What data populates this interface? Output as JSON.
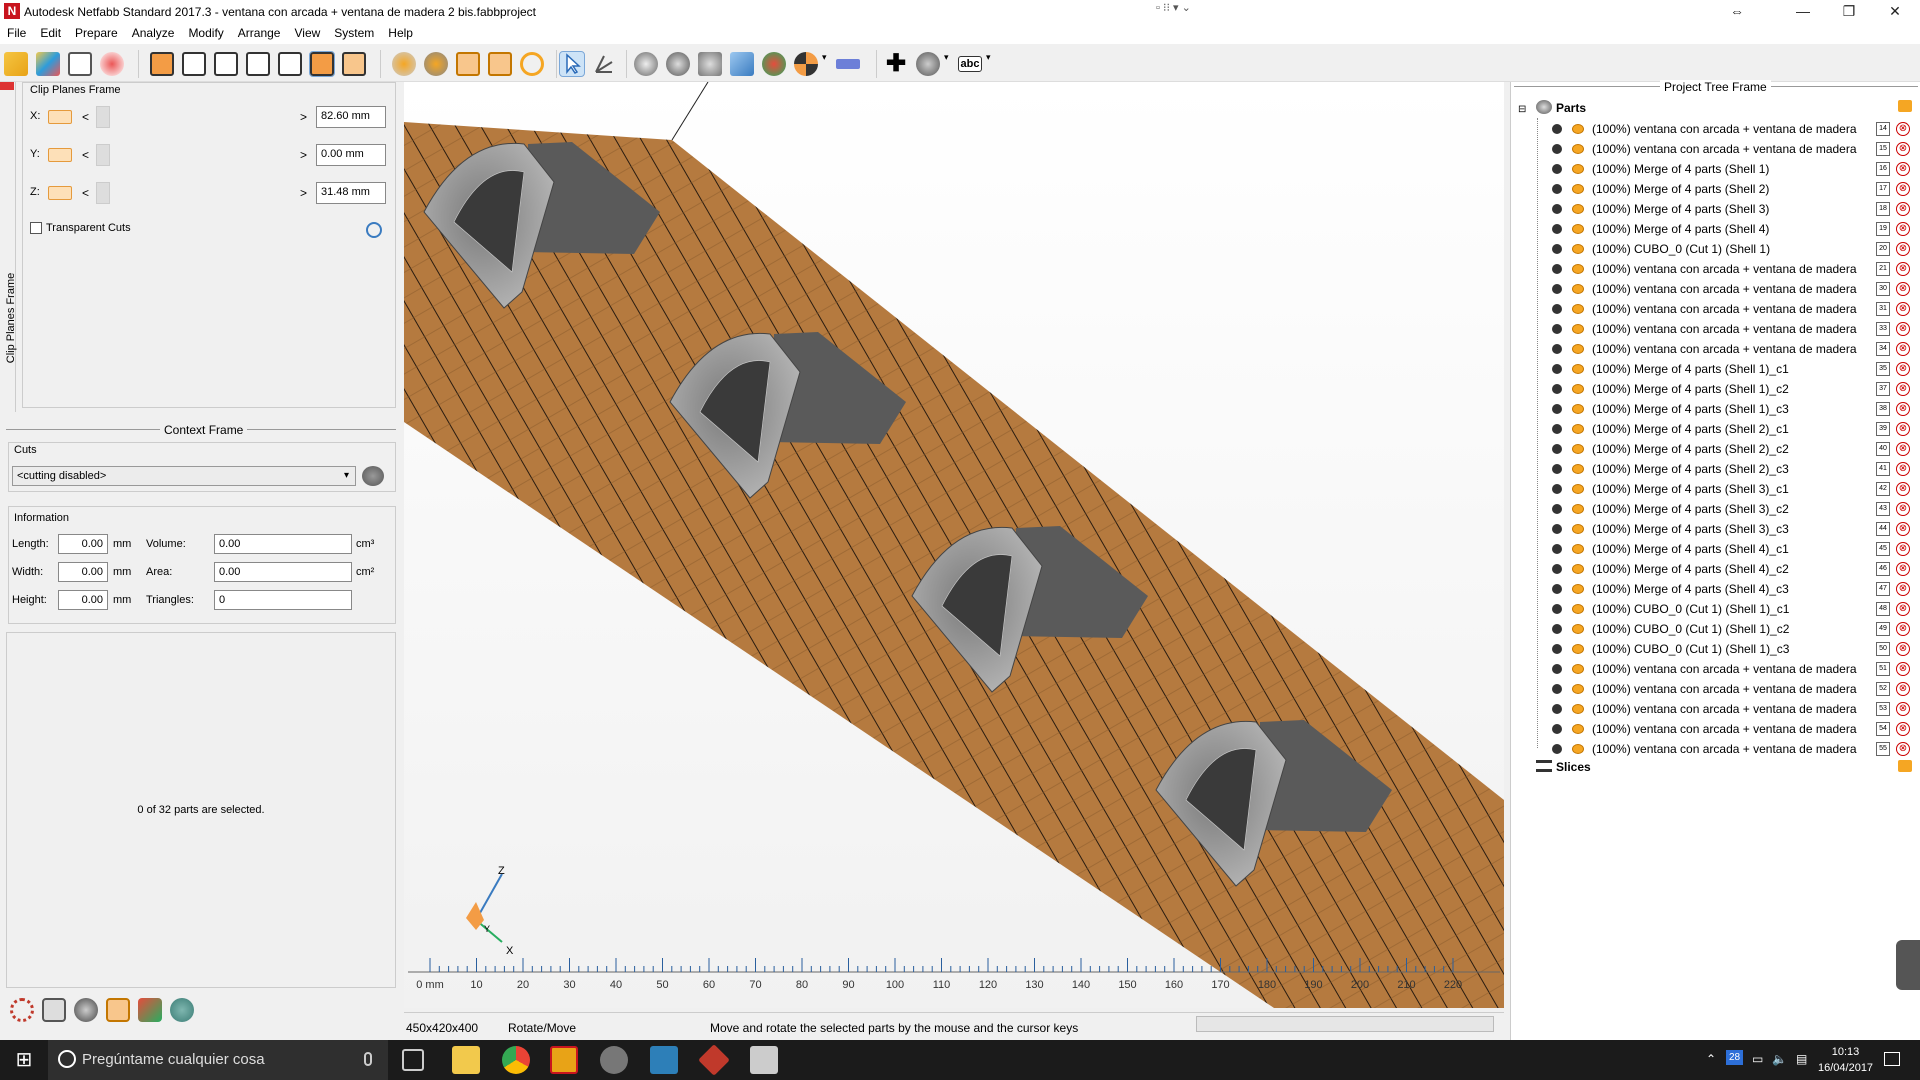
{
  "window": {
    "title": "Autodesk Netfabb Standard 2017.3 - ventana con arcada + ventana de madera 2 bis.fabbproject",
    "app_icon": "N",
    "controls": [
      "⇔",
      "—",
      "❐",
      "✕"
    ],
    "mini_controls": "▫ ⁝⁝ ▾ ⌄"
  },
  "menu": [
    "File",
    "Edit",
    "Prepare",
    "Analyze",
    "Modify",
    "Arrange",
    "View",
    "System",
    "Help"
  ],
  "clip_planes": {
    "tab_label": "Clip Planes Frame",
    "title": "Clip Planes Frame",
    "axes": [
      {
        "label": "X:",
        "value": "82.60 mm"
      },
      {
        "label": "Y:",
        "value": "0.00 mm"
      },
      {
        "label": "Z:",
        "value": "31.48 mm"
      }
    ],
    "arrow_left": "<",
    "arrow_right": ">",
    "transparent_cuts": "Transparent Cuts"
  },
  "context": {
    "title": "Context Frame",
    "cuts_label": "Cuts",
    "cuts_value": "<cutting disabled>",
    "info_label": "Information",
    "length_label": "Length:",
    "length_value": "0.00",
    "width_label": "Width:",
    "width_value": "0.00",
    "height_label": "Height:",
    "height_value": "0.00",
    "unit_mm": "mm",
    "volume_label": "Volume:",
    "volume_value": "0.00",
    "area_label": "Area:",
    "area_value": "0.00",
    "triangles_label": "Triangles:",
    "triangles_value": "0",
    "unit_cm3": "cm³",
    "unit_cm2": "cm²",
    "selection_text": "0 of 32 parts are selected."
  },
  "ruler": {
    "labels": [
      "0 mm",
      "10",
      "20",
      "30",
      "40",
      "50",
      "60",
      "70",
      "80",
      "90",
      "100",
      "110",
      "120",
      "130",
      "140",
      "150",
      "160",
      "170",
      "180",
      "190",
      "200",
      "210",
      "220"
    ]
  },
  "axes_gizmo": {
    "z": "Z",
    "x": "X",
    "y": "Y"
  },
  "status": {
    "dimensions": "450x420x400",
    "mode": "Rotate/Move",
    "hint": "Move and rotate the selected parts by the mouse and the cursor keys"
  },
  "tree": {
    "title": "Project Tree Frame",
    "root": "Parts",
    "slices": "Slices",
    "items": [
      {
        "text": "(100%) ventana con arcada + ventana de madera",
        "num": "14"
      },
      {
        "text": "(100%) ventana con arcada + ventana de madera",
        "num": "15"
      },
      {
        "text": "(100%) Merge of 4 parts (Shell 1)",
        "num": "16"
      },
      {
        "text": "(100%) Merge of 4 parts (Shell 2)",
        "num": "17"
      },
      {
        "text": "(100%) Merge of 4 parts (Shell 3)",
        "num": "18"
      },
      {
        "text": "(100%) Merge of 4 parts (Shell 4)",
        "num": "19"
      },
      {
        "text": "(100%) CUBO_0 (Cut 1) (Shell 1)",
        "num": "20"
      },
      {
        "text": "(100%) ventana con arcada + ventana de madera",
        "num": "21"
      },
      {
        "text": "(100%) ventana con arcada + ventana de madera",
        "num": "30"
      },
      {
        "text": "(100%) ventana con arcada + ventana de madera",
        "num": "31"
      },
      {
        "text": "(100%) ventana con arcada + ventana de madera",
        "num": "33"
      },
      {
        "text": "(100%) ventana con arcada + ventana de madera",
        "num": "34"
      },
      {
        "text": "(100%) Merge of 4 parts (Shell 1)_c1",
        "num": "35"
      },
      {
        "text": "(100%) Merge of 4 parts (Shell 1)_c2",
        "num": "37"
      },
      {
        "text": "(100%) Merge of 4 parts (Shell 1)_c3",
        "num": "38"
      },
      {
        "text": "(100%) Merge of 4 parts (Shell 2)_c1",
        "num": "39"
      },
      {
        "text": "(100%) Merge of 4 parts (Shell 2)_c2",
        "num": "40"
      },
      {
        "text": "(100%) Merge of 4 parts (Shell 2)_c3",
        "num": "41"
      },
      {
        "text": "(100%) Merge of 4 parts (Shell 3)_c1",
        "num": "42"
      },
      {
        "text": "(100%) Merge of 4 parts (Shell 3)_c2",
        "num": "43"
      },
      {
        "text": "(100%) Merge of 4 parts (Shell 3)_c3",
        "num": "44"
      },
      {
        "text": "(100%) Merge of 4 parts (Shell 4)_c1",
        "num": "45"
      },
      {
        "text": "(100%) Merge of 4 parts (Shell 4)_c2",
        "num": "46"
      },
      {
        "text": "(100%) Merge of 4 parts (Shell 4)_c3",
        "num": "47"
      },
      {
        "text": "(100%) CUBO_0 (Cut 1) (Shell 1)_c1",
        "num": "48"
      },
      {
        "text": "(100%) CUBO_0 (Cut 1) (Shell 1)_c2",
        "num": "49"
      },
      {
        "text": "(100%) CUBO_0 (Cut 1) (Shell 1)_c3",
        "num": "50"
      },
      {
        "text": "(100%) ventana con arcada + ventana de madera",
        "num": "51"
      },
      {
        "text": "(100%) ventana con arcada + ventana de madera",
        "num": "52"
      },
      {
        "text": "(100%) ventana con arcada + ventana de madera",
        "num": "53"
      },
      {
        "text": "(100%) ventana con arcada + ventana de madera",
        "num": "54"
      },
      {
        "text": "(100%) ventana con arcada + ventana de madera",
        "num": "55"
      }
    ]
  },
  "taskbar": {
    "search_placeholder": "Pregúntame cualquier cosa",
    "time": "10:13",
    "date": "16/04/2017",
    "badge": "28"
  },
  "colors": {
    "plate": "#b57a3f",
    "plate_stripe": "#2a1c10",
    "part_dark": "#5a5a5a",
    "part_light": "#a0a0a0"
  }
}
